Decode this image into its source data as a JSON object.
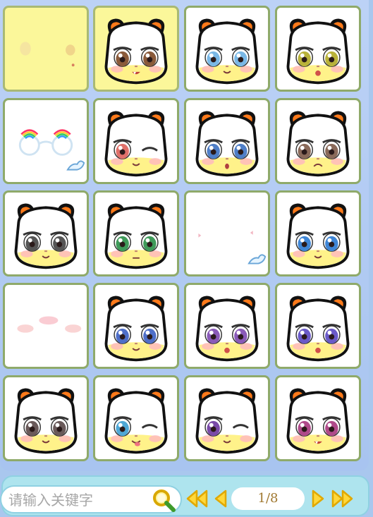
{
  "items": [
    {
      "kind": "blush-small",
      "selected": true
    },
    {
      "kind": "face",
      "eyes": "#8a5a3a",
      "mouth": "fang",
      "selected": true
    },
    {
      "kind": "face",
      "eyes": "#7ab8e6",
      "mouth": "smile"
    },
    {
      "kind": "face",
      "eyes": "#b9b23a",
      "mouth": "open"
    },
    {
      "kind": "glasses"
    },
    {
      "kind": "face",
      "eyes": "#e0706a",
      "mouth": "smile",
      "wink": true
    },
    {
      "kind": "face",
      "eyes": "#4f7fc8",
      "mouth": "o"
    },
    {
      "kind": "face",
      "eyes": "#8a6a5a",
      "mouth": "frown"
    },
    {
      "kind": "face",
      "eyes": "#555555",
      "mouth": "smile"
    },
    {
      "kind": "face",
      "eyes": "#3f9a5a",
      "mouth": "line"
    },
    {
      "kind": "sparkle"
    },
    {
      "kind": "face",
      "eyes": "#3f86d6",
      "mouth": "smile"
    },
    {
      "kind": "blush"
    },
    {
      "kind": "face",
      "eyes": "#4f6fc8",
      "mouth": "smile"
    },
    {
      "kind": "face",
      "eyes": "#8a5ab8",
      "mouth": "open"
    },
    {
      "kind": "face",
      "eyes": "#6a5ac8",
      "mouth": "open"
    },
    {
      "kind": "face",
      "eyes": "#6a5a5a",
      "mouth": "smile"
    },
    {
      "kind": "face",
      "eyes": "#4fa8d6",
      "mouth": "tongue",
      "wink": true
    },
    {
      "kind": "face",
      "eyes": "#7a4aa8",
      "mouth": "smile",
      "wink": true
    },
    {
      "kind": "face",
      "eyes": "#b04a8a",
      "mouth": "fang"
    }
  ],
  "search": {
    "placeholder": "请输入关键字"
  },
  "pagination": {
    "label": "1/8"
  },
  "icons": {
    "search": "magnifier-icon",
    "first": "double-left-icon",
    "prev": "left-icon",
    "next": "right-icon",
    "last": "double-right-icon"
  }
}
